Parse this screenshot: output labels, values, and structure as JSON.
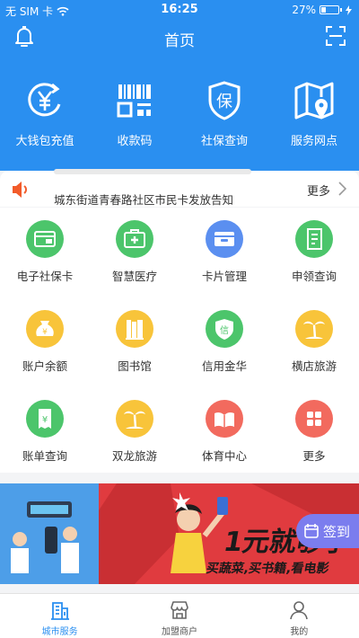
{
  "status_bar": {
    "carrier": "无 SIM 卡",
    "time": "16:25",
    "battery": "27%",
    "battery_level": 0.27
  },
  "nav": {
    "title": "首页"
  },
  "quick_actions": [
    {
      "label": "大钱包充值",
      "icon": "yuan-refresh-icon"
    },
    {
      "label": "收款码",
      "icon": "qr-code-icon"
    },
    {
      "label": "社保查询",
      "icon": "shield-bao-icon"
    },
    {
      "label": "服务网点",
      "icon": "map-pin-icon"
    }
  ],
  "notice": {
    "text": "城东街道青春路社区市民卡发放告知",
    "more": "更多"
  },
  "services": [
    {
      "label": "电子社保卡",
      "icon": "card-icon",
      "color": "#4cc56b"
    },
    {
      "label": "智慧医疗",
      "icon": "medical-kit-icon",
      "color": "#4cc56b"
    },
    {
      "label": "卡片管理",
      "icon": "wallet-icon",
      "color": "#5b8ff0"
    },
    {
      "label": "申领查询",
      "icon": "document-icon",
      "color": "#4cc56b"
    },
    {
      "label": "账户余额",
      "icon": "money-bag-icon",
      "color": "#f8c43a"
    },
    {
      "label": "图书馆",
      "icon": "books-icon",
      "color": "#f8c43a"
    },
    {
      "label": "信用金华",
      "icon": "credit-shield-icon",
      "color": "#4cc56b"
    },
    {
      "label": "横店旅游",
      "icon": "palm-tree-icon",
      "color": "#f8c43a"
    },
    {
      "label": "账单查询",
      "icon": "bill-icon",
      "color": "#4cc56b"
    },
    {
      "label": "双龙旅游",
      "icon": "palm-tree-icon",
      "color": "#f8c43a"
    },
    {
      "label": "体育中心",
      "icon": "open-book-icon",
      "color": "#f26a5e"
    },
    {
      "label": "更多",
      "icon": "grid-icon",
      "color": "#f26a5e"
    }
  ],
  "banner": {
    "promo_title": "1元就够了",
    "promo_sub": "买蔬菜,买书籍,看电影",
    "checkin": "签到"
  },
  "tabbar": [
    {
      "label": "城市服务",
      "icon": "city-building-icon",
      "active": true
    },
    {
      "label": "加盟商户",
      "icon": "storefront-icon",
      "active": false
    },
    {
      "label": "我的",
      "icon": "person-icon",
      "active": false
    }
  ],
  "colors": {
    "primary": "#2a8ff0",
    "green": "#4cc56b",
    "yellow": "#f8c43a",
    "red": "#f26a5e",
    "banner_red": "#e03b3f"
  }
}
